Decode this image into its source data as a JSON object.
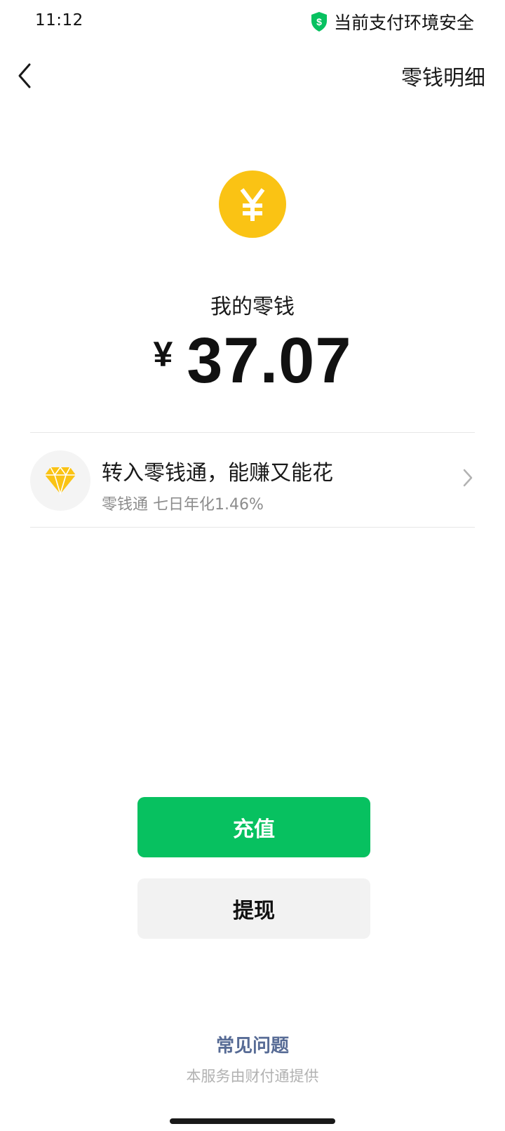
{
  "status_bar": {
    "time": "11:12",
    "secure_text": "当前支付环境安全",
    "secure_icon": "shield-dollar-icon",
    "secure_color": "#07C160"
  },
  "nav": {
    "back_icon": "chevron-left-icon",
    "right_link": "零钱明细"
  },
  "balance": {
    "icon": "yen-coin-icon",
    "icon_color": "#FAC314",
    "label": "我的零钱",
    "currency": "¥",
    "amount": "37.07"
  },
  "promo": {
    "icon": "diamond-icon",
    "title": "转入零钱通，能赚又能花",
    "subtitle": "零钱通 七日年化1.46%"
  },
  "actions": {
    "recharge_label": "充值",
    "recharge_color": "#07C160",
    "withdraw_label": "提现"
  },
  "footer": {
    "faq_label": "常见问题",
    "provider_text": "本服务由财付通提供"
  }
}
